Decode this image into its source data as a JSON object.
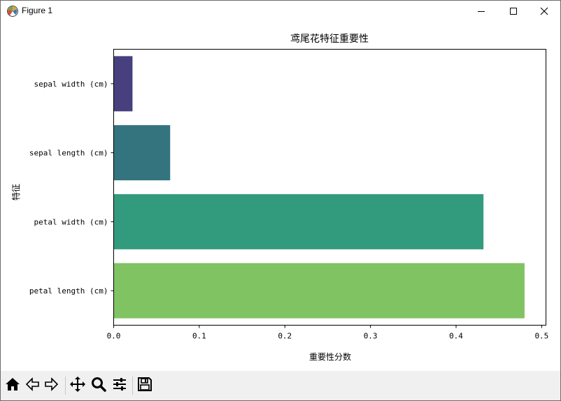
{
  "window": {
    "title": "Figure 1",
    "app_icon": "matplotlib-icon",
    "controls": [
      "minimize-icon",
      "maximize-icon",
      "close-icon"
    ]
  },
  "toolbar": {
    "tools": [
      "home-icon",
      "back-icon",
      "forward-icon",
      "pan-icon",
      "zoom-icon",
      "configure-subplots-icon",
      "save-icon"
    ]
  },
  "chart_data": {
    "type": "bar",
    "orientation": "horizontal",
    "title": "鸢尾花特征重要性",
    "xlabel": "重要性分数",
    "ylabel": "特征",
    "categories": [
      "sepal width (cm)",
      "sepal length (cm)",
      "petal width (cm)",
      "petal length (cm)"
    ],
    "values": [
      0.022,
      0.066,
      0.432,
      0.48
    ],
    "colors": [
      "#46407e",
      "#33747f",
      "#339b7d",
      "#80c363"
    ],
    "xlim": [
      0.0,
      0.505
    ],
    "xticks": [
      "0.0",
      "0.1",
      "0.2",
      "0.3",
      "0.4",
      "0.5"
    ],
    "grid": false,
    "legend": "none"
  }
}
